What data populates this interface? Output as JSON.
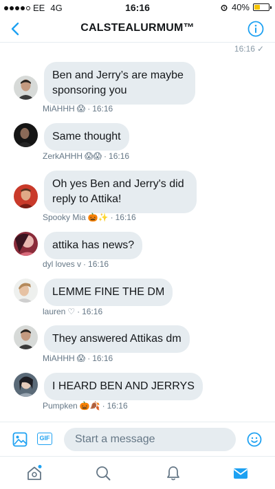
{
  "status_bar": {
    "carrier": "EE",
    "network": "4G",
    "time": "16:16",
    "battery": "40%",
    "battery_level": 0.4
  },
  "nav": {
    "title": "CALSTEALURMUM™"
  },
  "sent_meta": {
    "time": "16:16",
    "check": "✓"
  },
  "messages": [
    {
      "text": "Ben and Jerry’s are maybe sponsoring you",
      "sender": "MiAHHH",
      "emoji": "😱",
      "time": "16:16"
    },
    {
      "text": "Same thought",
      "sender": "ZerkAHHH",
      "emoji": "😱😱",
      "time": "16:16"
    },
    {
      "text": "Oh yes Ben and Jerry's did reply to Attika!",
      "sender": "Spooky Mia",
      "emoji": "🎃✨",
      "time": "16:16"
    },
    {
      "text": "attika has news?",
      "sender": "dyl loves v",
      "emoji": "",
      "time": "16:16"
    },
    {
      "text": "LEMME FINE THE DM",
      "sender": "lauren",
      "emoji": "♡",
      "time": "16:16"
    },
    {
      "text": "They answered Attikas dm",
      "sender": "MiAHHH",
      "emoji": "😱",
      "time": "16:16"
    },
    {
      "text": "I HEARD BEN AND JERRYS",
      "sender": "Pumpken",
      "emoji": "🎃🍂",
      "time": "16:16"
    }
  ],
  "composer": {
    "placeholder": "Start a message",
    "gif_label": "GIF"
  },
  "tabs": [
    "home-icon",
    "search-icon",
    "notifications-icon",
    "messages-icon"
  ],
  "colors": {
    "accent": "#1da1f2",
    "bubble": "#e6ecf0",
    "meta_text": "#657786"
  }
}
